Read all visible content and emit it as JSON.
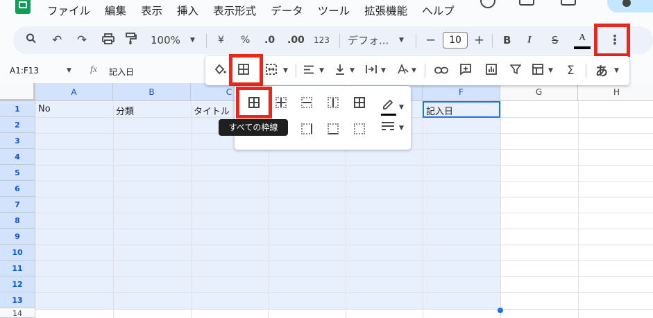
{
  "menubar": {
    "items": [
      "ファイル",
      "編集",
      "表示",
      "挿入",
      "表示形式",
      "データ",
      "ツール",
      "拡張機能",
      "ヘルプ"
    ]
  },
  "toolbar": {
    "zoom": "100%",
    "currency": "¥",
    "percent": "%",
    "dec_decrease": ".0",
    "dec_increase": ".00",
    "number_format": "123",
    "font": "デフォ...",
    "minus": "−",
    "font_size": "10",
    "plus": "+",
    "bold": "B",
    "italic": "I",
    "strike": "S",
    "text_color": "A",
    "more": "⋮"
  },
  "overflow_toolbar": {
    "sigma": "Σ",
    "input_tools": "あ"
  },
  "formula_bar": {
    "name_box": "A1:F13",
    "fx": "fx",
    "value": "記入日"
  },
  "grid": {
    "columns": [
      "A",
      "B",
      "C",
      "D",
      "E",
      "F",
      "G",
      "H"
    ],
    "rows": [
      "1",
      "2",
      "3",
      "4",
      "5",
      "6",
      "7",
      "8",
      "9",
      "10",
      "11",
      "12",
      "13",
      "14"
    ],
    "cells": {
      "A1": "No",
      "B1": "分類",
      "C1": "タイトル",
      "F1": "記入日"
    }
  },
  "borders_menu": {
    "tooltip": "すべての枠線"
  },
  "colors": {
    "highlight": "#e8271f",
    "selection": "#e8f0fe",
    "selection_header": "#d3e3fd",
    "accent": "#1a73e8"
  }
}
